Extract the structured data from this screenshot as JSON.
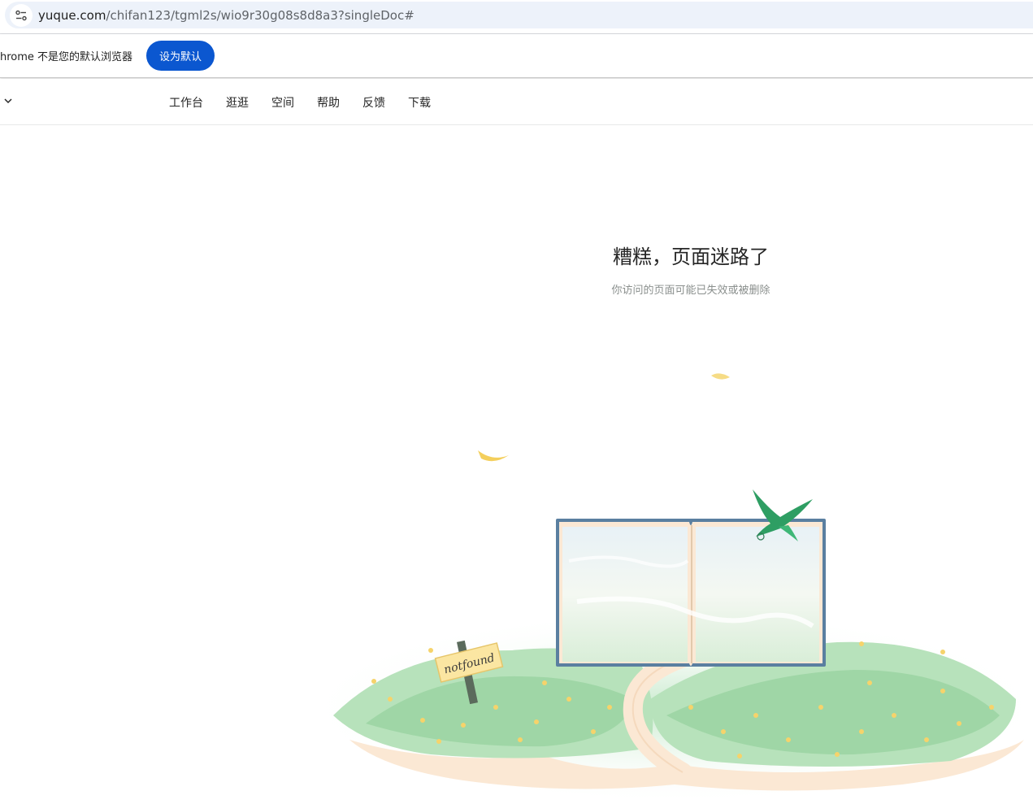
{
  "browser": {
    "url_host": "yuque.com",
    "url_path": "/chifan123/tgml2s/wio9r30g08s8d8a3?singleDoc#",
    "site_info_icon": "tune-icon",
    "infobar": {
      "message": "hrome 不是您的默认浏览器",
      "set_default_label": "设为默认"
    }
  },
  "nav": {
    "items": [
      {
        "label": "工作台"
      },
      {
        "label": "逛逛"
      },
      {
        "label": "空间"
      },
      {
        "label": "帮助"
      },
      {
        "label": "反馈"
      },
      {
        "label": "下载"
      }
    ]
  },
  "error": {
    "title": "糟糕，页面迷路了",
    "description": "你访问的页面可能已失效或被删除",
    "signpost_text": "notfound"
  },
  "colors": {
    "accent": "#0b57d0",
    "grass": "#8fd39a",
    "flower": "#f6d36b",
    "book_cover": "#5a7fa0",
    "bird": "#2e9e63"
  }
}
